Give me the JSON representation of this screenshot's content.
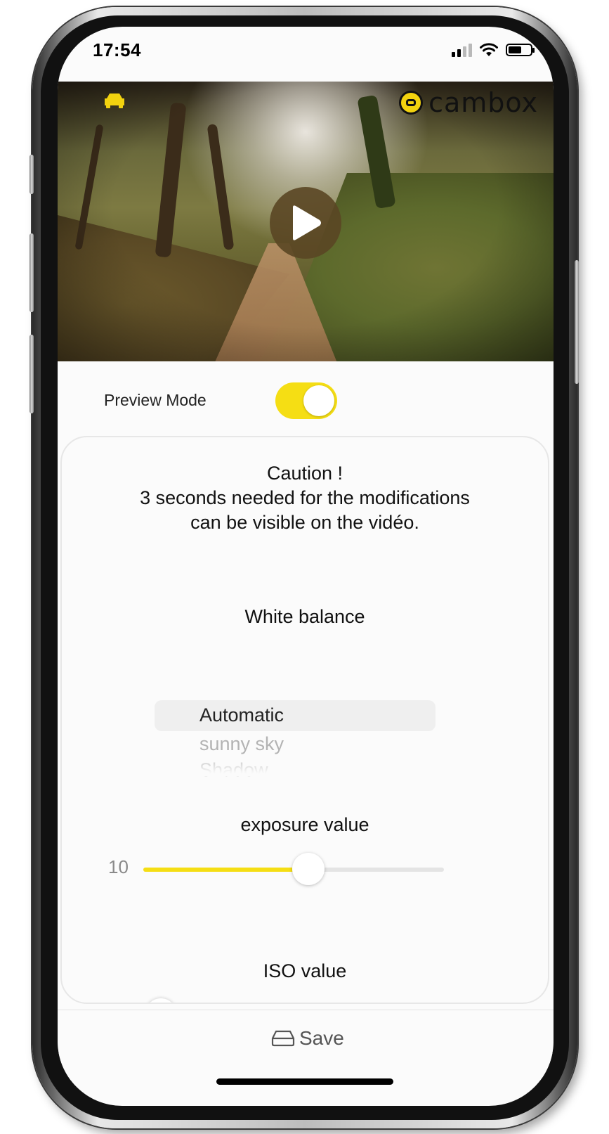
{
  "status_bar": {
    "time": "17:54",
    "battery_level": 0.6,
    "signal_bars": 2
  },
  "video": {
    "brand": "cambox",
    "icons": [
      "car-icon",
      "play-icon"
    ]
  },
  "preview_mode": {
    "label": "Preview Mode",
    "enabled": true
  },
  "settings": {
    "caution": "Caution !\n3 seconds needed for the modifications can be visible on the vidéo.",
    "white_balance": {
      "title": "White balance",
      "options": [
        "Automatic",
        "sunny sky",
        "Shadow"
      ],
      "selected": "Automatic"
    },
    "exposure": {
      "title": "exposure value",
      "value": "10",
      "fraction": 0.55
    },
    "iso": {
      "title": "ISO value"
    }
  },
  "footer": {
    "save_label": "Save",
    "icon": "storage-icon"
  },
  "colors": {
    "accent": "#f5de14",
    "brand_yellow": "#f2d20f"
  }
}
